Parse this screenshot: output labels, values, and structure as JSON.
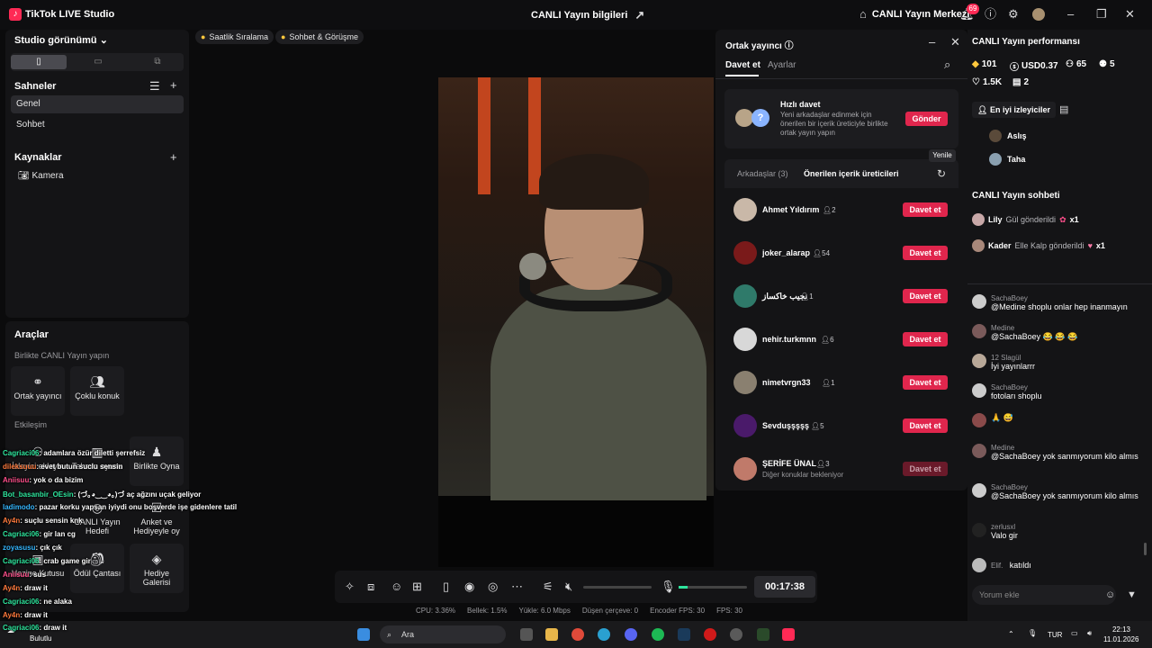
{
  "titlebar": {
    "app_name": "TikTok LIVE Studio",
    "center_title": "CANLI Yayın bilgileri",
    "live_center": "CANLI Yayın Merkezi",
    "notif_count": "69"
  },
  "left": {
    "view_title": "Studio görünümü",
    "scenes_title": "Sahneler",
    "scenes": [
      "Genel",
      "Sohbet"
    ],
    "sources_title": "Kaynaklar",
    "sources": [
      "Kamera"
    ],
    "tools_title": "Araçlar",
    "together_title": "Birlikte CANLI Yayın yapın",
    "tools_a": [
      "Ortak yayıncı",
      "Çoklu konuk"
    ],
    "engage_title": "Etkileşim",
    "tools_b": [
      "İzleyici ekleyin",
      "Tahmin oyunu",
      "CANLI Yayın Hedefi",
      "Birlikte Oyna",
      "Anket ve Hediyeyle oy",
      "Hazine Kutusu",
      "Ödül Çantası",
      "Hediye Galerisi"
    ]
  },
  "pills": [
    "Saatlik Sıralama",
    "Sohbet & Görüşme"
  ],
  "overlay_chat": [
    {
      "u": "Cagriaci06",
      "m": ": adamlara özür diletti şerrefsiz"
    },
    {
      "u": "dileksuuu",
      "m": ": evet butun suclu sensin"
    },
    {
      "u": "Aniisuu",
      "m": ": yok o da bizim"
    },
    {
      "u": "Bot_basanbir_OEsin",
      "m": ": (づ｡◕‿‿◕｡)づ aç ağzını uçak geliyor"
    },
    {
      "u": "ladimodo",
      "m": ": pazar korku yapsan iyiydi onu boşverde işe gidenlere tatil"
    },
    {
      "u": "Ay4n",
      "m": ": suçlu sensin knk"
    },
    {
      "u": "Cagriaci06",
      "m": ": gir lan cg"
    },
    {
      "u": "zoyasusu",
      "m": ": çık çık"
    },
    {
      "u": "Cagriaci06",
      "m": ": crab game gir"
    },
    {
      "u": "Aniisuu",
      "m": ": sus"
    },
    {
      "u": "Ay4n",
      "m": ": draw it"
    },
    {
      "u": "Cagriaci06",
      "m": ": ne alaka"
    },
    {
      "u": "Ay4n",
      "m": ": draw it"
    },
    {
      "u": "Cagriaci06",
      "m": ": draw it"
    }
  ],
  "controls": {
    "timer": "00:17:38"
  },
  "stats": [
    "CPU: 3.36%",
    "Bellek: 1.5%",
    "Yükle: 6.0 Mbps",
    "Düşen çerçeve: 0",
    "Encoder FPS: 30",
    "FPS: 30"
  ],
  "popup": {
    "title": "Ortak yayıncı",
    "tab_invite": "Davet et",
    "tab_settings": "Ayarlar",
    "quick_title": "Hızlı davet",
    "quick_desc": "Yeni arkadaşlar edinmek için önerilen bir içerik üreticiyle birlikte ortak yayın yapın",
    "send": "Gönder",
    "friends_tab": "Arkadaşlar (3)",
    "suggested_tab": "Önerilen içerik üreticileri",
    "tooltip": "Yenile",
    "users": [
      {
        "name": "Ahmet Yıldırım",
        "count": "2",
        "btn": "Davet et",
        "color": "#c9b8a8"
      },
      {
        "name": "joker_alarap",
        "count": "54",
        "btn": "Davet et",
        "color": "#7a1a1a"
      },
      {
        "name": "نجيب خاكساز",
        "count": "1",
        "btn": "Davet et",
        "color": "#2f7a6a"
      },
      {
        "name": "nehir.turkmnn",
        "count": "6",
        "btn": "Davet et",
        "color": "#d8d8d8"
      },
      {
        "name": "nimetvrgn33",
        "count": "1",
        "btn": "Davet et",
        "color": "#8a8070"
      },
      {
        "name": "Sevduşşşşş",
        "count": "5",
        "btn": "Davet et",
        "color": "#4a1a6a"
      },
      {
        "name": "ŞERİFE ÜNAL",
        "count": "3",
        "btn": "Davet et",
        "color": "#c07a6a",
        "sub": "Diğer konuklar bekleniyor"
      }
    ]
  },
  "right": {
    "perf_title": "CANLI Yayın performansı",
    "metrics": [
      "101",
      "USD0.37",
      "65",
      "5",
      "1.5K",
      "2"
    ],
    "top_viewers": "En iyi izleyiciler",
    "viewers": [
      "Aslış",
      "Taha"
    ],
    "chat_title": "CANLI Yayın sohbeti",
    "gifts": [
      {
        "name": "Lily",
        "text": "Gül gönderildi",
        "x": "x1"
      },
      {
        "name": "Kader",
        "text": "Elle Kalp gönderildi",
        "x": "x1"
      }
    ],
    "chat": [
      {
        "n": "SachaBoey",
        "m": "@Medine shoplu onlar hep inanmayın"
      },
      {
        "n": "Medine",
        "m": "@SachaBoey 😂 😂 😂"
      },
      {
        "n": "12 Slagül",
        "m": "İyi yayınlarrr"
      },
      {
        "n": "SachaBoey",
        "m": "fotoları shoplu"
      },
      {
        "n": "",
        "m": "🙏 😅"
      },
      {
        "n": "Medine",
        "m": "@SachaBoey yok sanmıyorum kilo almıs"
      },
      {
        "n": "SachaBoey",
        "m": "@SachaBoey yok sanmıyorum kilo almıs"
      },
      {
        "n": "zerlusxl",
        "m": "Valo gir"
      },
      {
        "n": "Elif.",
        "m": "katıldı"
      }
    ],
    "comment_placeholder": "Yorum ekle"
  },
  "taskbar": {
    "weather": "Bulutlu",
    "search": "Ara",
    "lang": "TUR",
    "time": "22:13",
    "date": "11.01.2026"
  }
}
